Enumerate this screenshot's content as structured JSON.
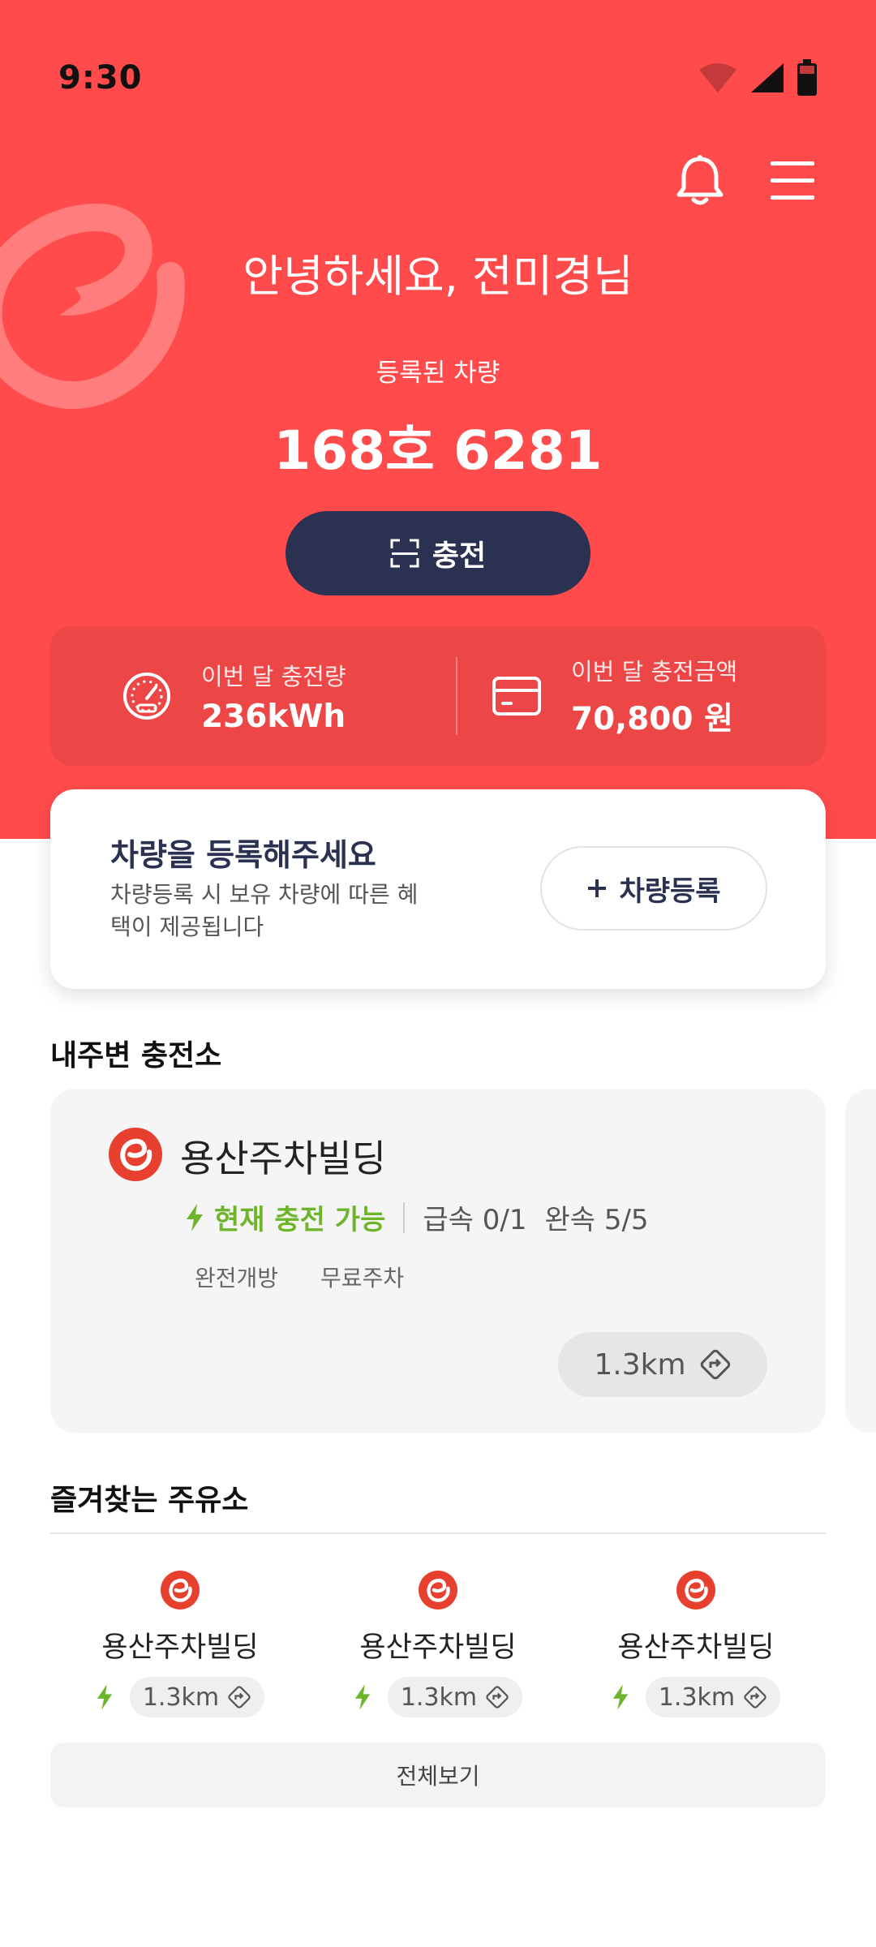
{
  "status_bar": {
    "time": "9:30"
  },
  "header": {
    "greeting": "안녕하세요, 전미경님",
    "car_label": "등록된 차량",
    "car_number": "168호 6281",
    "charge_button": "충전"
  },
  "stats": {
    "energy_label": "이번 달 충전량",
    "energy_value": "236kWh",
    "amount_label": "이번 달 충전금액",
    "amount_value": "70,800 원"
  },
  "register_card": {
    "title": "차량을 등록해주세요",
    "description": "차량등록 시 보유 차량에 따른 혜택이 제공됩니다",
    "button": "차량등록"
  },
  "nearby": {
    "title": "내주변 충전소",
    "station": {
      "name": "용산주차빌딩",
      "status": "현재 충전 가능",
      "fast": "급속 0/1",
      "slow": "완속 5/5",
      "tags": [
        "완전개방",
        "무료주차"
      ],
      "distance": "1.3km"
    }
  },
  "favorites": {
    "title": "즐겨찾는 주유소",
    "items": [
      {
        "name": "용산주차빌딩",
        "distance": "1.3km"
      },
      {
        "name": "용산주차빌딩",
        "distance": "1.3km"
      },
      {
        "name": "용산주차빌딩",
        "distance": "1.3km"
      }
    ],
    "view_all": "전체보기"
  },
  "colors": {
    "primary_red": "#FF4B4B",
    "navy": "#2B3150",
    "available_green": "#6FB52C"
  },
  "icons": [
    "wifi-icon",
    "signal-icon",
    "battery-icon",
    "bell-icon",
    "menu-icon",
    "scan-icon",
    "gauge-icon",
    "card-icon",
    "plus-icon",
    "bolt-icon",
    "direction-icon",
    "brand-logo-icon"
  ]
}
